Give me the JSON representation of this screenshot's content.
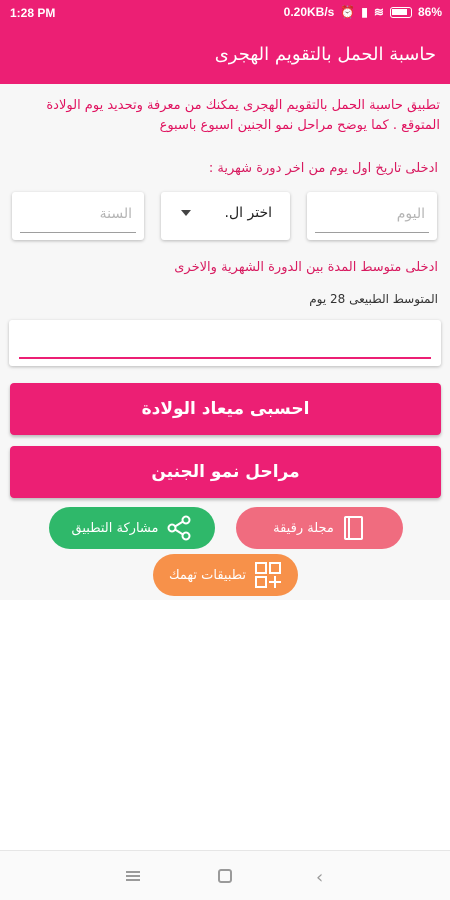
{
  "status_bar": {
    "time": "1:28 PM",
    "network_speed": "0.20KB/s",
    "battery": "86%"
  },
  "app_bar": {
    "title": "حاسبة الحمل بالتقويم الهجرى"
  },
  "intro_text": "تطبيق حاسبة الحمل بالتقويم الهجرى يمكنك من معرفة وتحديد يوم الولادة المتوقع . كما يوضح مراحل نمو الجنين اسبوع باسبوع",
  "date_section": {
    "label": "ادخلى تاريخ اول يوم من اخر دورة شهرية :",
    "day_placeholder": "اليوم",
    "month_select_value": "اختر ال.",
    "year_placeholder": "السنة"
  },
  "cycle_section": {
    "label": "ادخلى متوسط المدة بين الدورة الشهرية والاخرى",
    "hint": "المتوسط الطبيعى 28  يوم",
    "input_value": ""
  },
  "buttons": {
    "calculate_label": "احسبى ميعاد الولادة",
    "growth_label": "مراحل نمو الجنين"
  },
  "pills": {
    "magazine_label": "مجلة رقيقة",
    "share_label": "مشاركة التطبيق",
    "apps_label": "تطبيقات تهمك"
  },
  "colors": {
    "primary": "#ec1f74",
    "magazine_pill": "#f06c7f",
    "share_pill": "#2fb86a",
    "apps_pill": "#f7914a"
  }
}
